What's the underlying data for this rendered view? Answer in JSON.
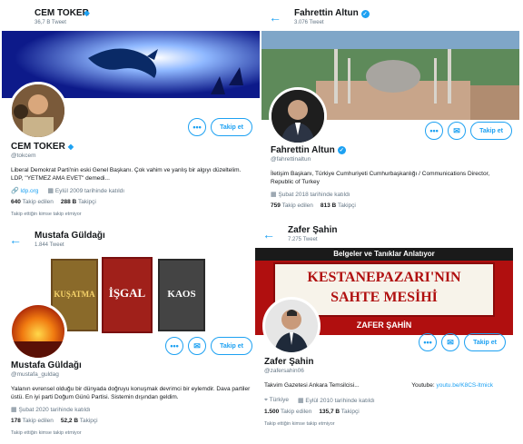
{
  "colors": {
    "accent": "#1da1f2",
    "text": "#14171a",
    "muted": "#657786"
  },
  "panels": [
    {
      "name": "CEM TOKER",
      "tweets": "36,7 B Tweet",
      "handle": "@tokcem",
      "bio": "Liberal Demokrat Parti'nin eski Genel Başkanı. Çok vahim ve yanlış bir algıyı düzeltelim. LDP, \"YETMEZ AMA EVET\" demedi...",
      "link": "ldp.org",
      "joined": "Eylül 2009 tarihinde katıldı",
      "following": "640",
      "following_label": "Takip edilen",
      "followers": "288 B",
      "followers_label": "Takipçi",
      "follow_button": "Takip et",
      "not_followed": "Takip ettiğin kimse takip etmiyor"
    },
    {
      "name": "Fahrettin Altun",
      "tweets": "3.076 Tweet",
      "handle": "@fahrettinaltun",
      "bio": "İletişim Başkanı, Türkiye Cumhuriyeti Cumhurbaşkanlığı / Communications Director, Republic of Turkey",
      "joined": "Şubat 2018 tarihinde katıldı",
      "following": "759",
      "following_label": "Takip edilen",
      "followers": "813 B",
      "followers_label": "Takipçi",
      "follow_button": "Takip et"
    },
    {
      "name": "Mustafa Güldağı",
      "tweets": "1.844 Tweet",
      "handle": "@mustafa_guldag",
      "bio": "Yalanın evrensel olduğu bir dünyada doğruyu konuşmak devrimci bir eylemdir. Dava partiler üstü. En iyi parti Doğum Günü Partisi. Sistemin dışından geldim.",
      "joined": "Şubat 2020 tarihinde katıldı",
      "following": "178",
      "following_label": "Takip edilen",
      "followers": "52,2 B",
      "followers_label": "Takipçi",
      "follow_button": "Takip et",
      "not_followed": "Takip ettiğin kimse takip etmiyor",
      "books": [
        "KUŞATMA",
        "İŞGAL",
        "KAOS"
      ]
    },
    {
      "name": "Zafer Şahin",
      "tweets": "7.275 Tweet",
      "handle": "@zafersahin06",
      "bio": "Takvim Gazetesi Ankara Temsilcisi...",
      "youtube_label": "Youtube:",
      "youtube_link": "youtu.be/K8CS-ltmick",
      "location": "Türkiye",
      "joined": "Eylül 2010 tarihinde katıldı",
      "following": "1.500",
      "following_label": "Takip edilen",
      "followers": "135,7 B",
      "followers_label": "Takipçi",
      "follow_button": "Takip et",
      "not_followed": "Takip ettiğin kimse takip etmiyor",
      "banner_line1": "Belgeler ve Tanıklar Anlatıyor",
      "banner_line2": "KESTANEPAZARI'NIN",
      "banner_line3": "SAHTE MESİHİ",
      "banner_line4": "ZAFER ŞAHİN"
    }
  ]
}
